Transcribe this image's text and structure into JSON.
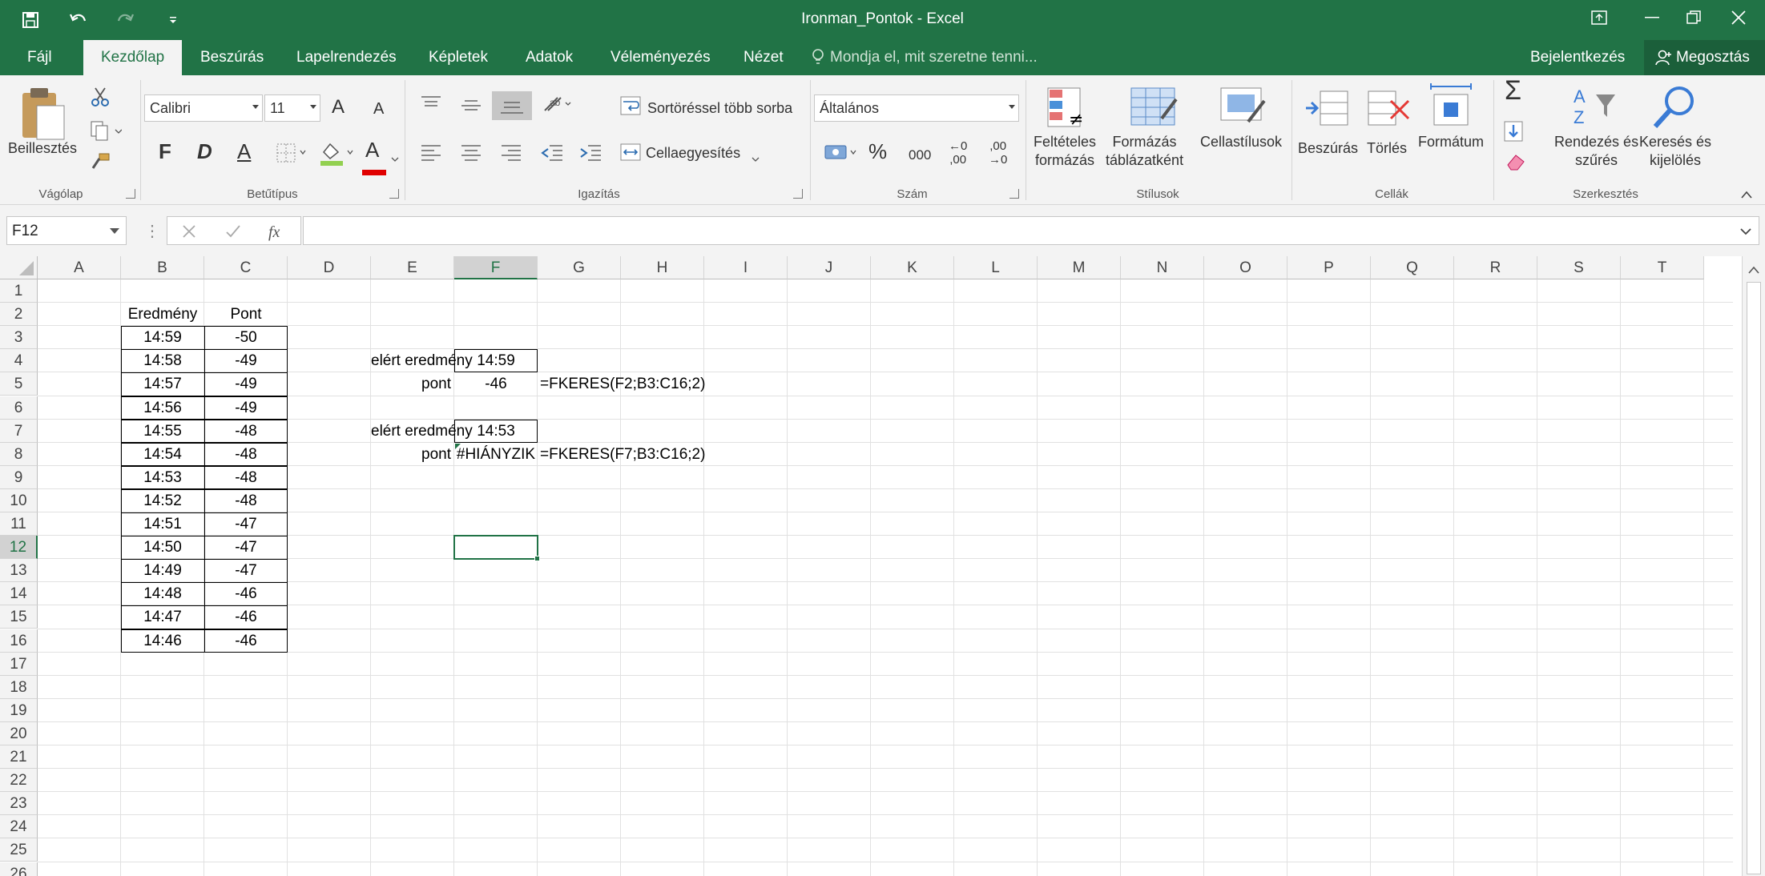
{
  "app": {
    "title": "Ironman_Pontok - Excel"
  },
  "tabs": [
    "Fájl",
    "Kezdőlap",
    "Beszúrás",
    "Lapelrendezés",
    "Képletek",
    "Adatok",
    "Véleményezés",
    "Nézet"
  ],
  "tell_me": "Mondja el, mit szeretne tenni...",
  "signin": "Bejelentkezés",
  "share": "Megosztás",
  "ribbon": {
    "clipboard": {
      "paste": "Beillesztés",
      "label": "Vágólap"
    },
    "font": {
      "name": "Calibri",
      "size": "11",
      "label": "Betűtípus",
      "bold": "F",
      "italic": "D",
      "underline": "A",
      "fontcolor": "A",
      "grow": "A",
      "shrink": "A"
    },
    "alignment": {
      "wrap": "Sortöréssel több sorba",
      "merge": "Cellaegyesítés",
      "label": "Igazítás"
    },
    "number": {
      "format": "Általános",
      "label": "Szám",
      "percent": "%",
      "thousands": "000",
      "inc_dec_a": "←0",
      "inc_dec_b": ",00",
      "dec_dec_a": ",00",
      "dec_dec_b": "→0"
    },
    "styles": {
      "cond_1": "Feltételes",
      "cond_2": "formázás",
      "table_1": "Formázás",
      "table_2": "táblázatként",
      "cell_styles": "Cellastílusok",
      "label": "Stílusok"
    },
    "cells": {
      "insert": "Beszúrás",
      "delete": "Törlés",
      "format": "Formátum",
      "label": "Cellák"
    },
    "editing": {
      "sort_1": "Rendezés és",
      "sort_2": "szűrés",
      "find_1": "Keresés és",
      "find_2": "kijelölés",
      "label": "Szerkesztés"
    }
  },
  "formula_bar": {
    "name_box": "F12",
    "formula": ""
  },
  "sheet": {
    "columns": [
      "A",
      "B",
      "C",
      "D",
      "E",
      "F",
      "G",
      "H",
      "I",
      "J",
      "K",
      "L",
      "M",
      "N",
      "O",
      "P",
      "Q",
      "R",
      "S",
      "T"
    ],
    "selected_col": "F",
    "selected_row": "12",
    "rows": [
      "1",
      "2",
      "3",
      "4",
      "5",
      "6",
      "7",
      "8",
      "9",
      "10",
      "11",
      "12",
      "13",
      "14",
      "15",
      "16",
      "17",
      "18",
      "19",
      "20",
      "21",
      "22",
      "23",
      "24",
      "25",
      "26"
    ],
    "table": {
      "headers": [
        "Eredmény",
        "Pont"
      ],
      "data": [
        [
          "14:59",
          "-50"
        ],
        [
          "14:58",
          "-49"
        ],
        [
          "14:57",
          "-49"
        ],
        [
          "14:56",
          "-49"
        ],
        [
          "14:55",
          "-48"
        ],
        [
          "14:54",
          "-48"
        ],
        [
          "14:53",
          "-48"
        ],
        [
          "14:52",
          "-48"
        ],
        [
          "14:51",
          "-47"
        ],
        [
          "14:50",
          "-47"
        ],
        [
          "14:49",
          "-47"
        ],
        [
          "14:48",
          "-46"
        ],
        [
          "14:47",
          "-46"
        ],
        [
          "14:46",
          "-46"
        ]
      ]
    },
    "lookup1": {
      "label": "elért eredmény",
      "value": "14:59",
      "pont_label": "pont",
      "pont_value": "-46",
      "formula": "=FKERES(F2;B3:C16;2)"
    },
    "lookup2": {
      "label": "elért eredmény",
      "value": "14:53",
      "pont_label": "pont",
      "pont_value": "#HIÁNYZIK",
      "formula": "=FKERES(F7;B3:C16;2)"
    }
  }
}
